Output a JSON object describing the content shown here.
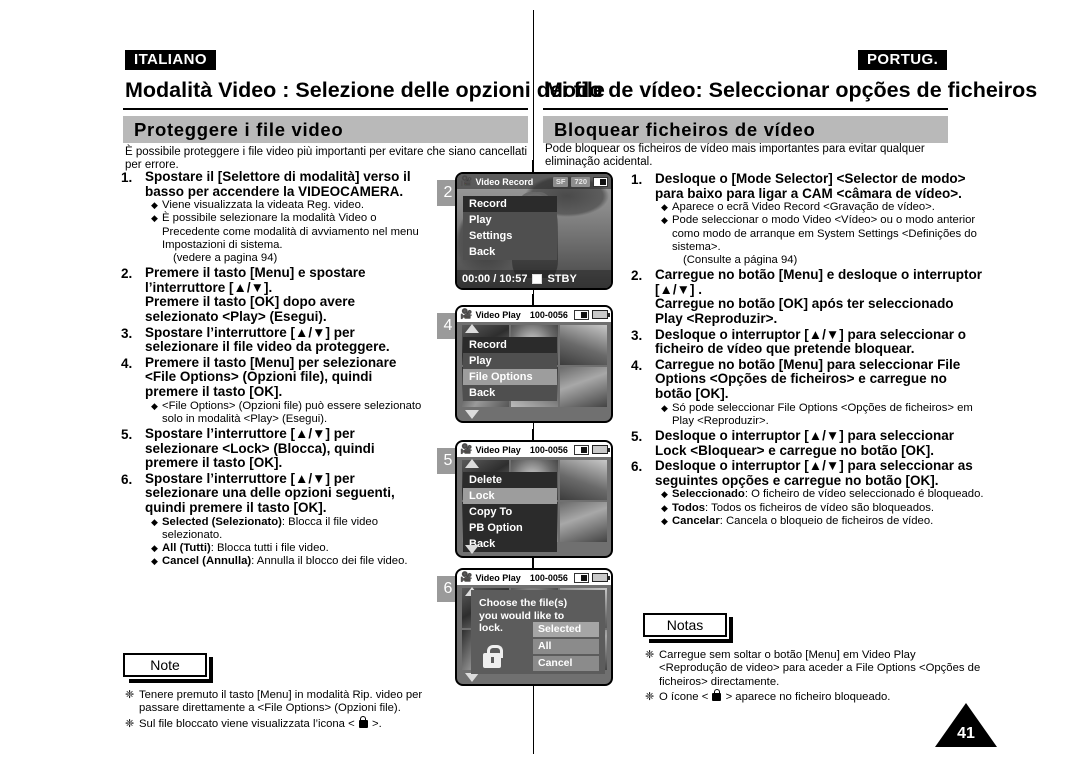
{
  "left": {
    "language_tag": "ITALIANO",
    "chapter_title": "Modalità Video : Selezione delle opzioni dei file",
    "section_title": "Proteggere i file video",
    "intro": "È possibile proteggere i file video più importanti per evitare che siano cancellati per errore.",
    "steps": [
      {
        "num": "1.",
        "head": "Spostare il [Selettore di modalità] verso il basso per accendere la VIDEOCAMERA.",
        "bullets": [
          {
            "text": "Viene visualizzata la videata Reg. video."
          },
          {
            "text": "È possibile selezionare la modalità Video  o Precedente come modalità di avviamento nel menu Impostazioni di sistema.",
            "extra": "(vedere a pagina 94)"
          }
        ]
      },
      {
        "num": "2.",
        "head": "Premere il tasto [Menu] e spostare l’interruttore [▲/▼].\nPremere il tasto [OK] dopo avere selezionato <Play> (Esegui).",
        "bullets": []
      },
      {
        "num": "3.",
        "head": "Spostare l’interruttore [▲/▼] per selezionare il file video da proteggere.",
        "bullets": []
      },
      {
        "num": "4.",
        "head": "Premere il tasto [Menu] per selezionare <File Options> (Opzioni file), quindi premere il tasto [OK].",
        "bullets": [
          {
            "text": "<File Options> (Opzioni file) può essere selezionato solo in modalità <Play> (Esegui)."
          }
        ]
      },
      {
        "num": "5.",
        "head": "Spostare l’interruttore [▲/▼] per selezionare <Lock> (Blocca), quindi premere il tasto [OK].",
        "bullets": []
      },
      {
        "num": "6.",
        "head": "Spostare l’interruttore [▲/▼] per selezionare una delle opzioni seguenti, quindi premere il tasto [OK].",
        "bullets": [
          {
            "bold": "Selected (Selezionato)",
            "text": ": Blocca il file video selezionato."
          },
          {
            "bold": "All (Tutti)",
            "text": ": Blocca tutti i file video."
          },
          {
            "bold": "Cancel (Annulla)",
            "text": ": Annulla il blocco dei file video."
          }
        ]
      }
    ],
    "note": {
      "label": "Note",
      "items": [
        {
          "text": "Tenere premuto il tasto [Menu] in modalità Rip. video per passare direttamente a <File Options> (Opzioni file)."
        },
        {
          "pre": "Sul file bloccato viene visualizzata l’icona < ",
          "post": " >.",
          "icon": "lock-icon"
        }
      ]
    }
  },
  "right": {
    "language_tag": "PORTUG.",
    "chapter_title": "Modo de vídeo: Seleccionar opções de ficheiros",
    "section_title": "Bloquear ficheiros de vídeo",
    "intro": "Pode bloquear os ficheiros de vídeo mais importantes para evitar qualquer eliminação acidental.",
    "steps": [
      {
        "num": "1.",
        "head": "Desloque o [Mode Selector] <Selector de modo> para baixo para ligar a CAM <câmara de vídeo>.",
        "bullets": [
          {
            "text": "Aparece o ecrã Video Record <Gravação de vídeo>."
          },
          {
            "text": "Pode seleccionar o modo Video <Vídeo> ou o modo anterior como modo de arranque em System Settings <Definições do sistema>.",
            "extra": "(Consulte a página 94)"
          }
        ]
      },
      {
        "num": "2.",
        "head": "Carregue no botão [Menu] e desloque o interruptor [▲/▼] .\nCarregue no botão [OK] após ter seleccionado Play <Reproduzir>.",
        "bullets": []
      },
      {
        "num": "3.",
        "head": "Desloque o interruptor [▲/▼] para seleccionar o ficheiro de vídeo que pretende bloquear.",
        "bullets": []
      },
      {
        "num": "4.",
        "head": "Carregue no botão [Menu] para seleccionar File Options <Opções de ficheiros> e carregue no botão [OK].",
        "bullets": [
          {
            "text": "Só pode seleccionar File Options <Opções de ficheiros> em Play <Reproduzir>."
          }
        ]
      },
      {
        "num": "5.",
        "head": "Desloque o interruptor [▲/▼] para seleccionar Lock <Bloquear> e carregue no botão [OK].",
        "bullets": []
      },
      {
        "num": "6.",
        "head": "Desloque o interruptor [▲/▼] para seleccionar as seguintes opções e carregue no botão [OK].",
        "bullets": [
          {
            "bold": "Seleccionado",
            "text": ": O ficheiro de vídeo seleccionado é bloqueado."
          },
          {
            "bold": "Todos",
            "text": ": Todos os ficheiros de vídeo são bloqueados."
          },
          {
            "bold": "Cancelar",
            "text": ": Cancela o bloqueio de ficheiros de vídeo."
          }
        ]
      }
    ],
    "note": {
      "label": "Notas",
      "items": [
        {
          "text": "Carregue sem soltar o botão [Menu] em Video Play <Reprodução de video> para aceder a File Options <Opções de ficheiros> directamente."
        },
        {
          "pre": "O ícone < ",
          "post": " > aparece no ficheiro bloqueado.",
          "icon": "lock-icon"
        }
      ]
    }
  },
  "figures": [
    {
      "badge": "2",
      "screen_title": "Video Record",
      "quality_badge": "SF",
      "resolution_badge": "720",
      "timecode": "00:00 / 10:57",
      "status": "STBY",
      "menu": [
        {
          "label": "Record",
          "state": "selected"
        },
        {
          "label": "Play",
          "state": "normal"
        },
        {
          "label": "Settings",
          "state": "normal"
        },
        {
          "label": "Back",
          "state": "normal"
        }
      ]
    },
    {
      "badge": "4",
      "screen_title": "Video Play",
      "file_number": "100-0056",
      "menu": [
        {
          "label": "Record",
          "state": "selected"
        },
        {
          "label": "Play",
          "state": "normal"
        },
        {
          "label": "File Options",
          "state": "dim"
        },
        {
          "label": "Back",
          "state": "normal"
        }
      ]
    },
    {
      "badge": "5",
      "screen_title": "Video Play",
      "file_number": "100-0056",
      "menu": [
        {
          "label": "Delete",
          "state": "selected"
        },
        {
          "label": "Lock",
          "state": "dim"
        },
        {
          "label": "Copy To",
          "state": "selected"
        },
        {
          "label": "PB Option",
          "state": "selected"
        },
        {
          "label": "Back",
          "state": "selected"
        }
      ]
    },
    {
      "badge": "6",
      "screen_title": "Video Play",
      "file_number": "100-0056",
      "dialog_text": "Choose the file(s) you would like to lock.",
      "dialog_options": [
        {
          "label": "Selected",
          "state": "highlight"
        },
        {
          "label": "All",
          "state": "normal"
        },
        {
          "label": "Cancel",
          "state": "normal"
        }
      ]
    }
  ],
  "page_number": "41",
  "colors": {
    "banner_gray": "#b9b9b9",
    "badge_gray": "#9a9a9a",
    "black": "#000000"
  }
}
